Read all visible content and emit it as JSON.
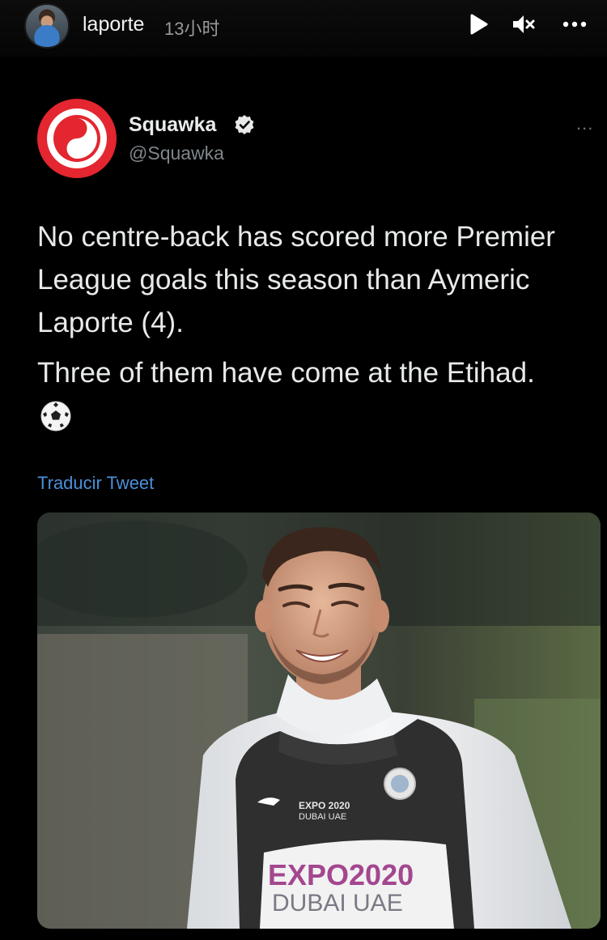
{
  "story": {
    "username": "laporte",
    "time": "13小时",
    "controls": {
      "play_icon": "play-icon",
      "mute_icon": "mute-icon",
      "more_icon": "more-icon"
    }
  },
  "tweet": {
    "author_name": "Squawka",
    "author_handle": "@Squawka",
    "verified": true,
    "menu_glyph": "...",
    "text_paragraph_1": "No centre-back has scored more Premier League goals this season than Aymeric Laporte (4).",
    "text_paragraph_2": "Three of them have come at the Etihad.",
    "emoji": "⚽",
    "translate_label": "Traducir Tweet",
    "photo": {
      "bib_text_small_1": "EXPO 2020",
      "bib_text_small_2": "DUBAI UAE",
      "bib_text_large_1": "EXPO2020",
      "bib_text_large_2": "DUBAI UAE"
    }
  },
  "colors": {
    "background": "#000000",
    "brand_red": "#e3262f",
    "link_blue": "#4a90d9",
    "text_primary": "#e7e9ea",
    "text_secondary": "#7f868b"
  }
}
